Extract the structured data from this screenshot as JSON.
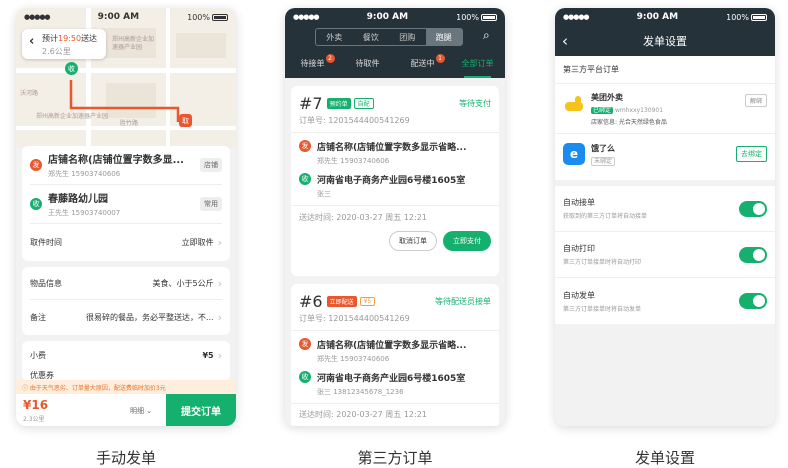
{
  "statusbar": {
    "signal": "●●●●●",
    "time": "9:00 AM",
    "battery": "100%"
  },
  "colors": {
    "green": "#15b06e",
    "orange": "#e8572e",
    "dark": "#26323a",
    "red_price": "#e8572e"
  },
  "p1": {
    "eta_label": "预计",
    "eta_time": "19:50",
    "eta_suffix": "送达",
    "distance": "2.6公里",
    "map_labels": {
      "m1": "郑州高新企业加",
      "m2": "速器产业园",
      "m3": "郑州高新企业加速器产业园",
      "m4": "沃河路",
      "m5": "胜竹路"
    },
    "pin_from": "取",
    "pin_to": "收",
    "sender": {
      "badge": "发",
      "name": "店铺名称(店铺位置字数多显...",
      "contact": "郑先生  15903740606",
      "tag": "店铺"
    },
    "receiver": {
      "badge": "收",
      "name": "春藤路幼儿园",
      "contact": "王先生  15903740007",
      "tag": "常用"
    },
    "pickup": {
      "label": "取件时间",
      "value": "立即取件"
    },
    "goods": {
      "label": "物品信息",
      "value": "美食、小于5公斤"
    },
    "remark": {
      "label": "备注",
      "value": "很易碎的餐品，务必平整送达，不..."
    },
    "tip": {
      "label": "小费",
      "value": "¥5"
    },
    "discount": {
      "label": "优惠券"
    },
    "notice": "由于天气恶劣、订单量大原因，配送费临时加价3元",
    "price": "¥16",
    "price_distance": "2.3公里",
    "detail": "明细",
    "submit": "提交订单"
  },
  "p2": {
    "seg": [
      "外卖",
      "餐饮",
      "团购",
      "跑腿"
    ],
    "tabs": [
      {
        "label": "待接单",
        "badge": "2"
      },
      {
        "label": "待取件",
        "badge": ""
      },
      {
        "label": "配送中",
        "badge": "1"
      },
      {
        "label": "全部订单",
        "badge": ""
      }
    ],
    "orders": [
      {
        "num": "#7",
        "tag1": "预约单",
        "tag2": "自配",
        "status": "等待支付",
        "order_no": "订单号: 1201544400541269",
        "from_badge": "发",
        "from": "店铺名称(店铺位置字数多显示省略...",
        "from_contact": "郑先生  15903740606",
        "to_badge": "收",
        "to": "河南省电子商务产业园6号楼1605室",
        "to_contact": "张三",
        "time": "送达时间: 2020-03-27 周五 12:21",
        "btn_cancel": "取消订单",
        "btn_pay": "立即支付"
      },
      {
        "num": "#6",
        "tag1": "立即配送",
        "tag2": "¥5",
        "status": "等待配送员接单",
        "order_no": "订单号: 1201544400541269",
        "from_badge": "发",
        "from": "店铺名称(店铺位置字数多显示省略...",
        "from_contact": "郑先生  15903740606",
        "to_badge": "收",
        "to": "河南省电子商务产业园6号楼1605室",
        "to_contact": "张三  13812345678_1236",
        "time": "送达时间: 2020-03-27 周五 12:21"
      }
    ]
  },
  "p3": {
    "title": "发单设置",
    "section": "第三方平台订单",
    "meituan": {
      "name": "美团外卖",
      "tag": "已绑定",
      "account": "wmhxxy130901",
      "store": "店家信息: 光合天然绿色食品",
      "btn": "解绑"
    },
    "eleme": {
      "name": "饿了么",
      "tag": "未绑定",
      "btn": "去绑定"
    },
    "settings": [
      {
        "title": "自动接单",
        "desc": "获取到的第三方订单将自动接单"
      },
      {
        "title": "自动打印",
        "desc": "第三方订单接单时将自动打印"
      },
      {
        "title": "自动发单",
        "desc": "第三方订单接单时将自动发单"
      }
    ]
  },
  "captions": [
    "手动发单",
    "第三方订单",
    "发单设置"
  ]
}
